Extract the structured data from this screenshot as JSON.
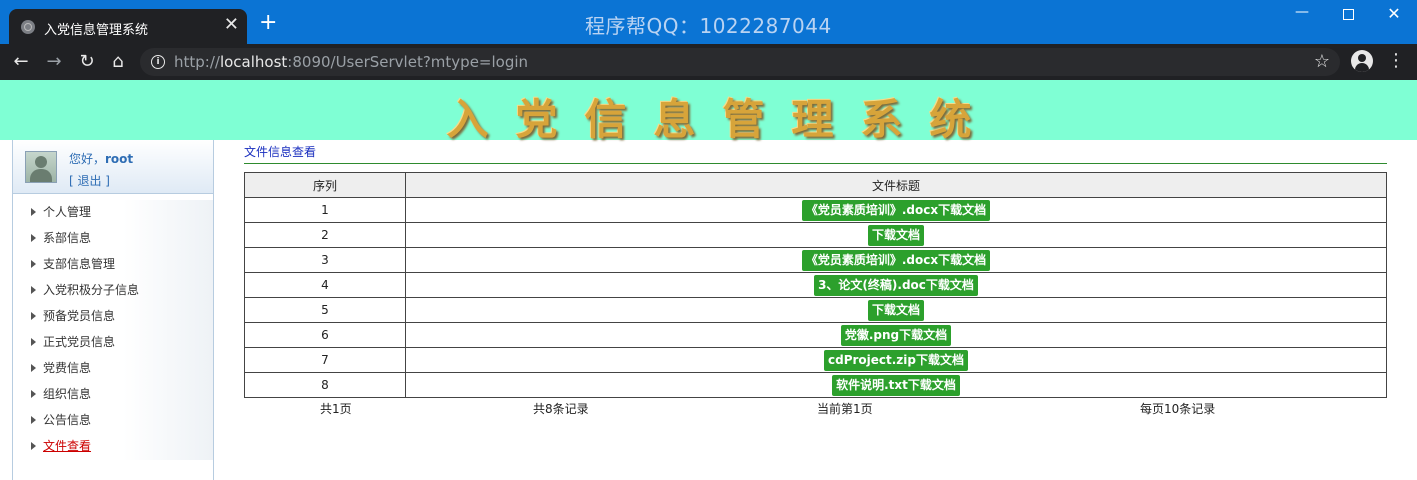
{
  "browser": {
    "tab_title": "入党信息管理系统",
    "tab_close": "✕",
    "new_tab": "+",
    "watermark": "程序帮QQ：1022287044",
    "url_prefix": "http://",
    "url_host": "localhost",
    "url_rest": ":8090/UserServlet?mtype=login"
  },
  "banner": {
    "title": "入党信息管理系统"
  },
  "user": {
    "greeting_prefix": "您好，",
    "name": "root",
    "logout": "[ 退出 ]"
  },
  "menu": [
    {
      "label": "个人管理"
    },
    {
      "label": "系部信息"
    },
    {
      "label": "支部信息管理"
    },
    {
      "label": "入党积极分子信息"
    },
    {
      "label": "预备党员信息"
    },
    {
      "label": "正式党员信息"
    },
    {
      "label": "党费信息"
    },
    {
      "label": "组织信息"
    },
    {
      "label": "公告信息"
    },
    {
      "label": "文件查看"
    }
  ],
  "content": {
    "breadcrumb": "文件信息查看",
    "columns": [
      "序列",
      "文件标题"
    ],
    "rows": [
      {
        "index": "1",
        "link": "《党员素质培训》.docx下载文档"
      },
      {
        "index": "2",
        "link": "下载文档"
      },
      {
        "index": "3",
        "link": "《党员素质培训》.docx下载文档"
      },
      {
        "index": "4",
        "link": "3、论文(终稿).doc下载文档"
      },
      {
        "index": "5",
        "link": "下载文档"
      },
      {
        "index": "6",
        "link": "党徽.png下载文档"
      },
      {
        "index": "7",
        "link": "cdProject.zip下载文档"
      },
      {
        "index": "8",
        "link": "软件说明.txt下载文档"
      }
    ],
    "pager": {
      "total_pages": "共1页",
      "total_records": "共8条记录",
      "current_page": "当前第1页",
      "per_page": "每页10条记录"
    }
  },
  "colors": {
    "banner": "#7fffd4",
    "titlebar": "#0b74d4",
    "download_button": "#2ca02c",
    "active_menu": "#cc0000"
  }
}
